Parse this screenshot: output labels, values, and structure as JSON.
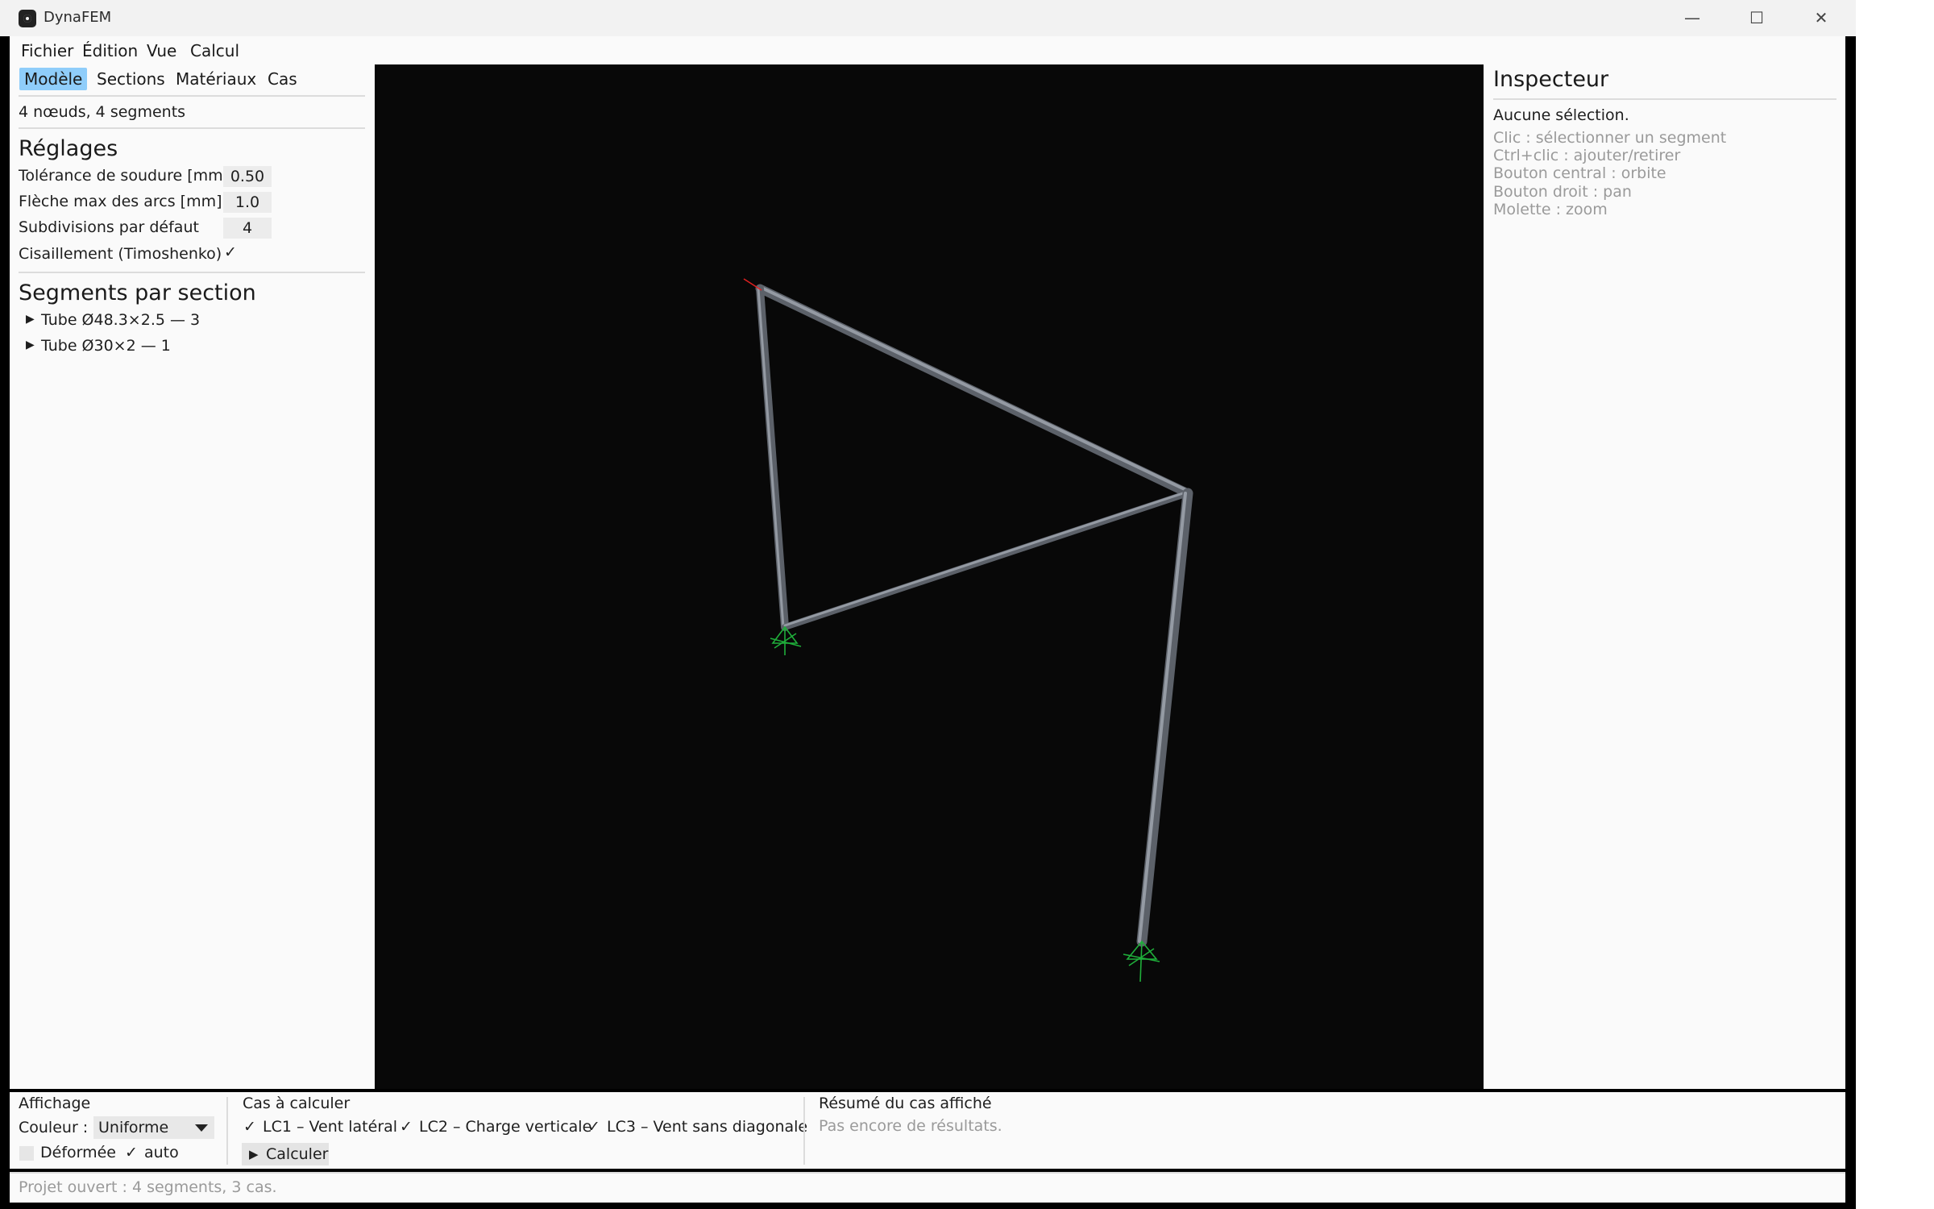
{
  "window": {
    "title": "DynaFEM",
    "minimize_glyph": "—",
    "maximize_glyph": "☐",
    "close_glyph": "✕"
  },
  "menu": {
    "file": "Fichier",
    "edit": "Édition",
    "view": "Vue",
    "compute": "Calcul"
  },
  "left": {
    "tabs": [
      "Modèle",
      "Sections",
      "Matériaux",
      "Cas"
    ],
    "active_tab": "Modèle",
    "model_summary": "4 nœuds, 4 segments",
    "settings_title": "Réglages",
    "weld_tolerance_label": "Tolérance de soudure [mm]",
    "weld_tolerance_value": "0.50",
    "arc_sag_label": "Flèche max des arcs [mm]",
    "arc_sag_value": "1.0",
    "subdivisions_label": "Subdivisions par défaut",
    "subdivisions_value": "4",
    "shear_label": "Cisaillement (Timoshenko)",
    "shear_checked": true,
    "segments_title": "Segments par section",
    "sections": [
      {
        "label": "Tube Ø48.3×2.5 — 3"
      },
      {
        "label": "Tube Ø30×2 — 1"
      }
    ]
  },
  "inspector": {
    "title": "Inspecteur",
    "selection": "Aucune sélection.",
    "hints": [
      "Clic : sélectionner un segment",
      "Ctrl+clic : ajouter/retirer",
      "Bouton central : orbite",
      "Bouton droit : pan",
      "Molette : zoom"
    ]
  },
  "bottom": {
    "display_title": "Affichage",
    "color_label": "Couleur :",
    "color_value": "Uniforme",
    "deformed_label": "Déformée",
    "deformed_checked": false,
    "auto_label": "auto",
    "auto_checked": true,
    "cases_title": "Cas à calculer",
    "cases": [
      {
        "label": "LC1 – Vent latéral",
        "checked": true
      },
      {
        "label": "LC2 – Charge verticale",
        "checked": true
      },
      {
        "label": "LC3 – Vent sans diagonale",
        "checked": true
      }
    ],
    "compute_button": "Calculer",
    "summary_title": "Résumé du cas affiché",
    "summary_text": "Pas encore de résultats."
  },
  "status": {
    "text": "Projet ouvert : 4 segments, 3 cas."
  },
  "colors": {
    "accent_tab": "#8fcdfa",
    "viewport_bg": "#080808",
    "beam": "#7d838c",
    "support": "#1fae3a",
    "axis_marker": "#e02020"
  },
  "icons": {
    "app": "dynafem-logo-icon",
    "expand": "triangle-right-icon",
    "check": "check-icon",
    "dropdown": "chevron-down-icon",
    "play": "play-icon"
  }
}
